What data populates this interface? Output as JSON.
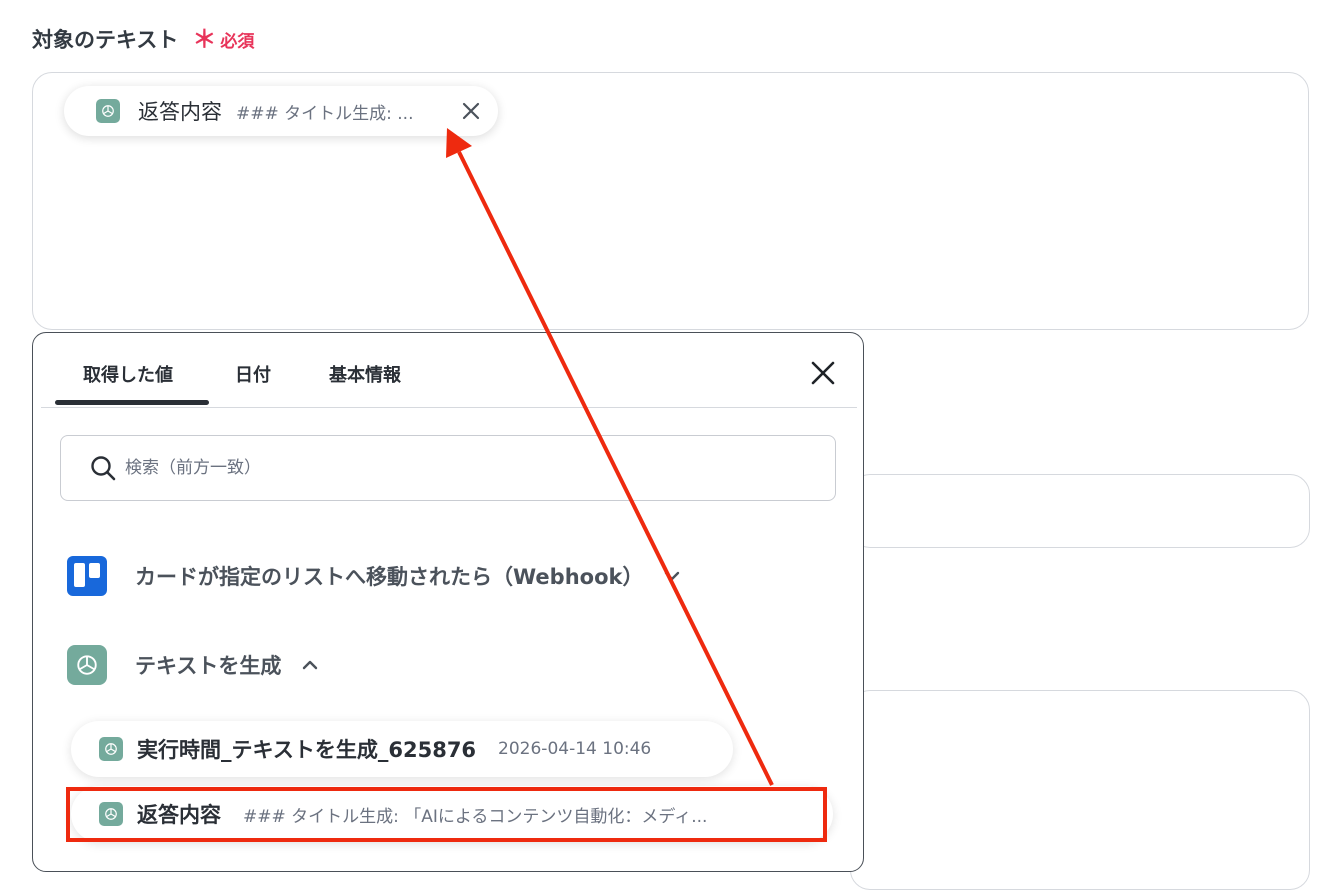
{
  "field": {
    "label": "対象のテキスト",
    "required_mark": "＊",
    "required_text": "必須"
  },
  "chip": {
    "label": "返答内容",
    "value": "### タイトル生成: ..."
  },
  "popup": {
    "tabs": [
      "取得した値",
      "日付",
      "基本情報"
    ],
    "active_tab": 0,
    "search_placeholder": "検索（前方一致）",
    "groups": [
      {
        "icon": "trello-icon",
        "label": "カードが指定のリストへ移動されたら（Webhook）",
        "expanded": false
      },
      {
        "icon": "openai-icon",
        "label": "テキストを生成",
        "expanded": true
      }
    ],
    "items": [
      {
        "label": "実行時間_テキストを生成_625876",
        "value": "2026-04-14 10:46"
      },
      {
        "label": "返答内容",
        "value": "### タイトル生成: 「AIによるコンテンツ自動化：メディ..."
      }
    ]
  },
  "colors": {
    "required": "#e8345a",
    "openai": "#74aa9c",
    "trello": "#1868db",
    "annotation": "#ee2a0f"
  }
}
